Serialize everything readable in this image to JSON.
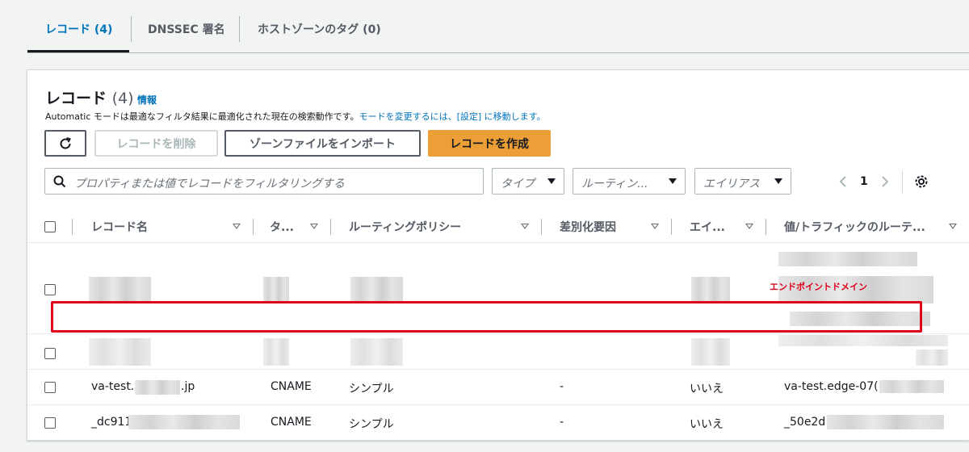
{
  "tabs": [
    {
      "label": "レコード (4)",
      "active": true
    },
    {
      "label": "DNSSEC 署名",
      "active": false
    },
    {
      "label": "ホストゾーンのタグ (0)",
      "active": false
    }
  ],
  "panel": {
    "title": "レコード",
    "count": "(4)",
    "info_link": "情報",
    "description": "Automatic モードは最適なフィルタ結果に最適化された現在の検索動作です。",
    "description_link": "モードを変更するには、[設定] に移動します。"
  },
  "toolbar": {
    "refresh_icon": "refresh-icon",
    "delete_label": "レコードを削除",
    "import_label": "ゾーンファイルをインポート",
    "create_label": "レコードを作成"
  },
  "filters": {
    "search_placeholder": "プロパティまたは値でレコードをフィルタリングする",
    "type_label": "タイプ",
    "routing_label": "ルーティン...",
    "alias_label": "エイリアス"
  },
  "pagination": {
    "page": "1"
  },
  "columns": {
    "name": "レコード名",
    "type": "タ...",
    "routing": "ルーティングポリシー",
    "differentiator": "差別化要因",
    "alias": "エイ...",
    "value": "値/トラフィックのルーテ..."
  },
  "rows": [
    {
      "name": "",
      "type": "",
      "routing": "",
      "differentiator": "",
      "alias": "",
      "value": ""
    },
    {
      "name": "",
      "type": "",
      "routing": "",
      "differentiator": "",
      "alias": "",
      "value": ""
    },
    {
      "name_prefix": "va-test.",
      "name_suffix": ".jp",
      "type": "CNAME",
      "routing": "シンプル",
      "differentiator": "-",
      "alias": "いいえ",
      "value": "va-test.edge-07("
    },
    {
      "name_prefix": "_dc911",
      "name_suffix": "",
      "type": "CNAME",
      "routing": "シンプル",
      "differentiator": "-",
      "alias": "いいえ",
      "value": "_50e2d"
    }
  ],
  "annotation": {
    "text": "エンドポイントドメイン",
    "color": "#e0001b"
  },
  "colors": {
    "accent": "#0073bb",
    "primary_button": "#ec9f36",
    "highlight": "#e0001b"
  }
}
